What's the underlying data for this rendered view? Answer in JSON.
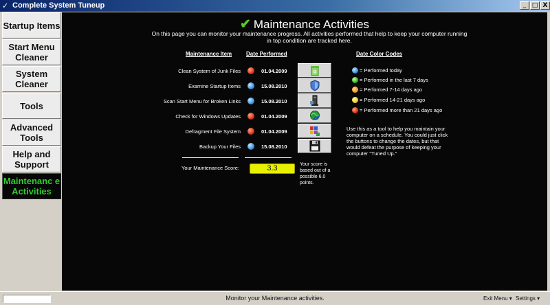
{
  "window": {
    "title": "Complete System Tuneup",
    "minimize_glyph": "_",
    "maximize_glyph": "□",
    "close_glyph": "X"
  },
  "sidebar": {
    "items": [
      {
        "label": "Startup Items",
        "active": false
      },
      {
        "label": "Start Menu Cleaner",
        "active": false
      },
      {
        "label": "System Cleaner",
        "active": false
      },
      {
        "label": "Tools",
        "active": false
      },
      {
        "label": "Advanced Tools",
        "active": false
      },
      {
        "label": "Help and Support",
        "active": false
      },
      {
        "label": "Maintenanc e Activities",
        "active": true
      }
    ]
  },
  "main": {
    "title": "Maintenance Activities",
    "intro": "On this page you can monitor your maintenance progress. All activities performed that help to keep your computer running in top condition are tracked here.",
    "col_item": "Maintenance Item",
    "col_date": "Date Performed",
    "tasks": [
      {
        "label": "Clean System of Junk Files",
        "status": "red",
        "date": "01.04.2009",
        "icon": "recycle-bin-icon"
      },
      {
        "label": "Examine Startup Items",
        "status": "blue",
        "date": "15.08.2010",
        "icon": "shield-icon"
      },
      {
        "label": "Scan Start Menu for Broken Links",
        "status": "blue",
        "date": "15.08.2010",
        "icon": "computer-icon"
      },
      {
        "label": "Check for Windows Updates",
        "status": "red",
        "date": "01.04.2009",
        "icon": "globe-update-icon"
      },
      {
        "label": "Defragment File System",
        "status": "red",
        "date": "01.04.2009",
        "icon": "defragment-icon"
      },
      {
        "label": "Backup Your Files",
        "status": "blue",
        "date": "15.08.2010",
        "icon": "floppy-disk-icon"
      }
    ],
    "score_label": "Your Maintenance Score:",
    "score": "3.3",
    "score_note": "Your score is based out of a possible 6.0 points.",
    "legend_title": "Date Color Codes",
    "legend": [
      {
        "color": "blue",
        "text": "= Performed today"
      },
      {
        "color": "green",
        "text": "= Performed in the last 7 days"
      },
      {
        "color": "orange",
        "text": "= Performed 7-14 days ago"
      },
      {
        "color": "yellow",
        "text": "= Performed 14-21 days ago"
      },
      {
        "color": "red",
        "text": "= Performed more than 21 days ago"
      }
    ],
    "advice": "Use this as a tool to help you maintain your computer on a schedule. You could just click the buttons to change the dates, but that would defeat the purpose of keeping your computer \"Tuned Up.\""
  },
  "statusbar": {
    "text": "Monitor your Maintenance activities.",
    "exit_menu": "Exit Menu ▾",
    "settings": "Settings ▾"
  },
  "colors": {
    "accent_active": "#33cc33",
    "panel_bg": "#070707",
    "score_bg": "#e8f000"
  }
}
